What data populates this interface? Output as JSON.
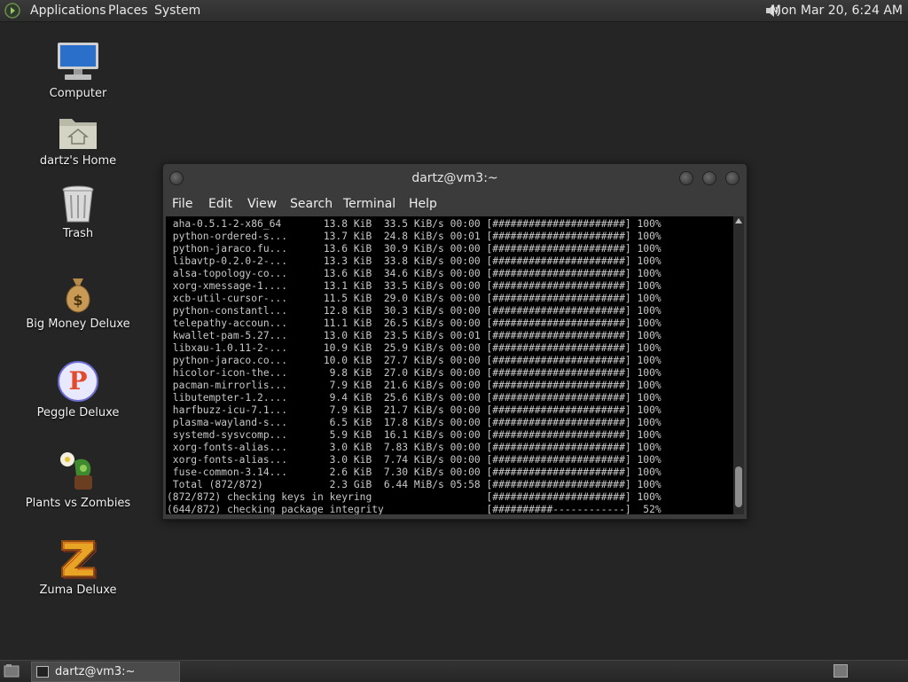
{
  "top_panel": {
    "menus": [
      "Applications",
      "Places",
      "System"
    ],
    "clock": "Mon Mar 20,  6:24 AM",
    "volume_icon": "speaker-icon"
  },
  "desktop_icons": [
    {
      "label": "Computer",
      "icon": "computer-icon"
    },
    {
      "label": "dartz's Home",
      "icon": "home-folder-icon"
    },
    {
      "label": "Trash",
      "icon": "trash-icon"
    },
    {
      "label": "Big Money Deluxe",
      "icon": "money-bag-icon"
    },
    {
      "label": "Peggle Deluxe",
      "icon": "peggle-icon"
    },
    {
      "label": "Plants vs Zombies",
      "icon": "plants-vs-zombies-icon"
    },
    {
      "label": "Zuma Deluxe",
      "icon": "zuma-icon"
    }
  ],
  "terminal": {
    "title": "dartz@vm3:~",
    "menu": [
      "File",
      "Edit",
      "View",
      "Search",
      "Terminal",
      "Help"
    ],
    "lines": [
      " aha-0.5.1-2-x86_64       13.8 KiB  33.5 KiB/s 00:00 [######################] 100%",
      " python-ordered-s...      13.7 KiB  24.8 KiB/s 00:01 [######################] 100%",
      " python-jaraco.fu...      13.6 KiB  30.9 KiB/s 00:00 [######################] 100%",
      " libavtp-0.2.0-2-...      13.3 KiB  33.8 KiB/s 00:00 [######################] 100%",
      " alsa-topology-co...      13.6 KiB  34.6 KiB/s 00:00 [######################] 100%",
      " xorg-xmessage-1....      13.1 KiB  33.5 KiB/s 00:00 [######################] 100%",
      " xcb-util-cursor-...      11.5 KiB  29.0 KiB/s 00:00 [######################] 100%",
      " python-constantl...      12.8 KiB  30.3 KiB/s 00:00 [######################] 100%",
      " telepathy-accoun...      11.1 KiB  26.5 KiB/s 00:00 [######################] 100%",
      " kwallet-pam-5.27...      13.0 KiB  23.5 KiB/s 00:01 [######################] 100%",
      " libxau-1.0.11-2-...      10.9 KiB  25.9 KiB/s 00:00 [######################] 100%",
      " python-jaraco.co...      10.0 KiB  27.7 KiB/s 00:00 [######################] 100%",
      " hicolor-icon-the...       9.8 KiB  27.0 KiB/s 00:00 [######################] 100%",
      " pacman-mirrorlis...       7.9 KiB  21.6 KiB/s 00:00 [######################] 100%",
      " libutempter-1.2....       9.4 KiB  25.6 KiB/s 00:00 [######################] 100%",
      " harfbuzz-icu-7.1...       7.9 KiB  21.7 KiB/s 00:00 [######################] 100%",
      " plasma-wayland-s...       6.5 KiB  17.8 KiB/s 00:00 [######################] 100%",
      " systemd-sysvcomp...       5.9 KiB  16.1 KiB/s 00:00 [######################] 100%",
      " xorg-fonts-alias...       3.0 KiB  7.83 KiB/s 00:00 [######################] 100%",
      " xorg-fonts-alias...       3.0 KiB  7.74 KiB/s 00:00 [######################] 100%",
      " fuse-common-3.14...       2.6 KiB  7.30 KiB/s 00:00 [######################] 100%",
      " Total (872/872)           2.3 GiB  6.44 MiB/s 05:58 [######################] 100%",
      "(872/872) checking keys in keyring                   [######################] 100%",
      "(644/872) checking package integrity                 [##########------------]  52%"
    ]
  },
  "taskbar": {
    "task_label": "dartz@vm3:~",
    "show_desktop_icon": "show-desktop-icon",
    "workspace_icon": "workspace-switcher-icon"
  }
}
